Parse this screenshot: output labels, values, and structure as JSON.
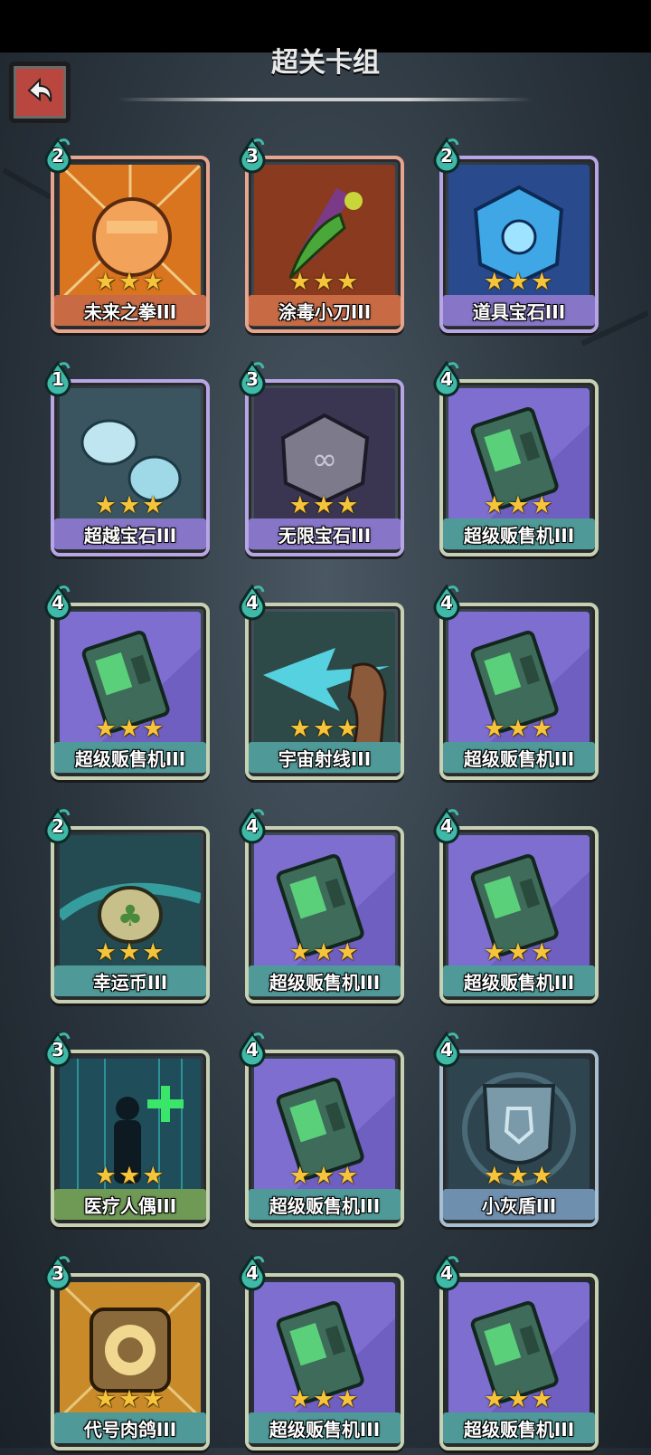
{
  "header": {
    "title": "超关卡组"
  },
  "cards": [
    {
      "name": "未来之拳III",
      "cost": "2",
      "rarity": "orange",
      "icon": "fist-icon",
      "art_color": "#d9741f"
    },
    {
      "name": "涂毒小刀III",
      "cost": "3",
      "rarity": "orange",
      "icon": "poison-dagger-icon",
      "art_color": "#8a3a1e"
    },
    {
      "name": "道具宝石III",
      "cost": "2",
      "rarity": "purple",
      "icon": "blue-gem-icon",
      "art_color": "#2a4a8e"
    },
    {
      "name": "超越宝石III",
      "cost": "1",
      "rarity": "purple",
      "icon": "twin-gems-icon",
      "art_color": "#3a5560"
    },
    {
      "name": "无限宝石III",
      "cost": "3",
      "rarity": "purple",
      "icon": "infinity-stone-icon",
      "art_color": "#3a3550"
    },
    {
      "name": "超级贩售机III",
      "cost": "4",
      "rarity": "teal",
      "icon": "vending-machine-icon",
      "art_color": "#6f5fc0"
    },
    {
      "name": "超级贩售机III",
      "cost": "4",
      "rarity": "teal",
      "icon": "vending-machine-icon",
      "art_color": "#6f5fc0"
    },
    {
      "name": "宇宙射线III",
      "cost": "4",
      "rarity": "teal",
      "icon": "cosmic-ray-icon",
      "art_color": "#2d4a48"
    },
    {
      "name": "超级贩售机III",
      "cost": "4",
      "rarity": "teal",
      "icon": "vending-machine-icon",
      "art_color": "#6f5fc0"
    },
    {
      "name": "幸运币III",
      "cost": "2",
      "rarity": "teal",
      "icon": "lucky-coin-icon",
      "art_color": "#244a52"
    },
    {
      "name": "超级贩售机III",
      "cost": "4",
      "rarity": "teal",
      "icon": "vending-machine-icon",
      "art_color": "#6f5fc0"
    },
    {
      "name": "超级贩售机III",
      "cost": "4",
      "rarity": "teal",
      "icon": "vending-machine-icon",
      "art_color": "#6f5fc0"
    },
    {
      "name": "医疗人偶III",
      "cost": "3",
      "rarity": "green",
      "icon": "medical-dummy-icon",
      "art_color": "#1f4e5a"
    },
    {
      "name": "超级贩售机III",
      "cost": "4",
      "rarity": "teal",
      "icon": "vending-machine-icon",
      "art_color": "#6f5fc0"
    },
    {
      "name": "小灰盾III",
      "cost": "4",
      "rarity": "steel",
      "icon": "gray-shield-icon",
      "art_color": "#2e4550"
    },
    {
      "name": "代号肉鸽III",
      "cost": "3",
      "rarity": "teal",
      "icon": "roguelike-portal-icon",
      "art_color": "#c98b2a"
    },
    {
      "name": "超级贩售机III",
      "cost": "4",
      "rarity": "teal",
      "icon": "vending-machine-icon",
      "art_color": "#6f5fc0"
    },
    {
      "name": "超级贩售机III",
      "cost": "4",
      "rarity": "teal",
      "icon": "vending-machine-icon",
      "art_color": "#6f5fc0"
    }
  ],
  "stars_per_card": 3,
  "colors": {
    "star": "#f5c43a",
    "cost_drop": "#3fb9a8",
    "back_button": "#b9473f"
  }
}
